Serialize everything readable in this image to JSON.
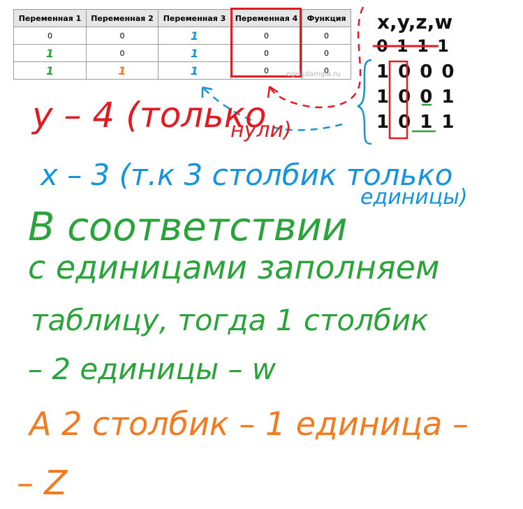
{
  "table": {
    "headers": [
      "Переменная 1",
      "Переменная 2",
      "Переменная 3",
      "Переменная 4",
      "Функция"
    ],
    "rows": [
      [
        "0",
        "0",
        "1",
        "0",
        "0"
      ],
      [
        "1",
        "0",
        "1",
        "0",
        "0"
      ],
      [
        "1",
        "1",
        "1",
        "0",
        "0"
      ]
    ],
    "highlighted_column": "Переменная 4"
  },
  "watermark": "egeisdamgia.ru",
  "sidebar": {
    "header": "x,y,z,w",
    "crossed_row": "0 1 1 1",
    "rows": [
      "1 0 0 0",
      "1 0 0 1",
      "1 0 1 1"
    ]
  },
  "notes": {
    "red_line": "y – 4 (только",
    "red_cont": "нули)",
    "blue_line1": "x – 3 (т.к 3 столбик только",
    "blue_line2": "единицы)",
    "green_line1": "В соответствии",
    "green_line2": "с единицами заполняем",
    "green_line3": "таблицу, тогда 1 столбик",
    "green_line4": "– 2 единицы – w",
    "orange_line1": "A 2 столбик – 1 единица –",
    "orange_line2": "– Z"
  },
  "colors": {
    "red": "#e21b23",
    "blue": "#1693dd",
    "green": "#2aa43a",
    "orange": "#f47a1f"
  }
}
